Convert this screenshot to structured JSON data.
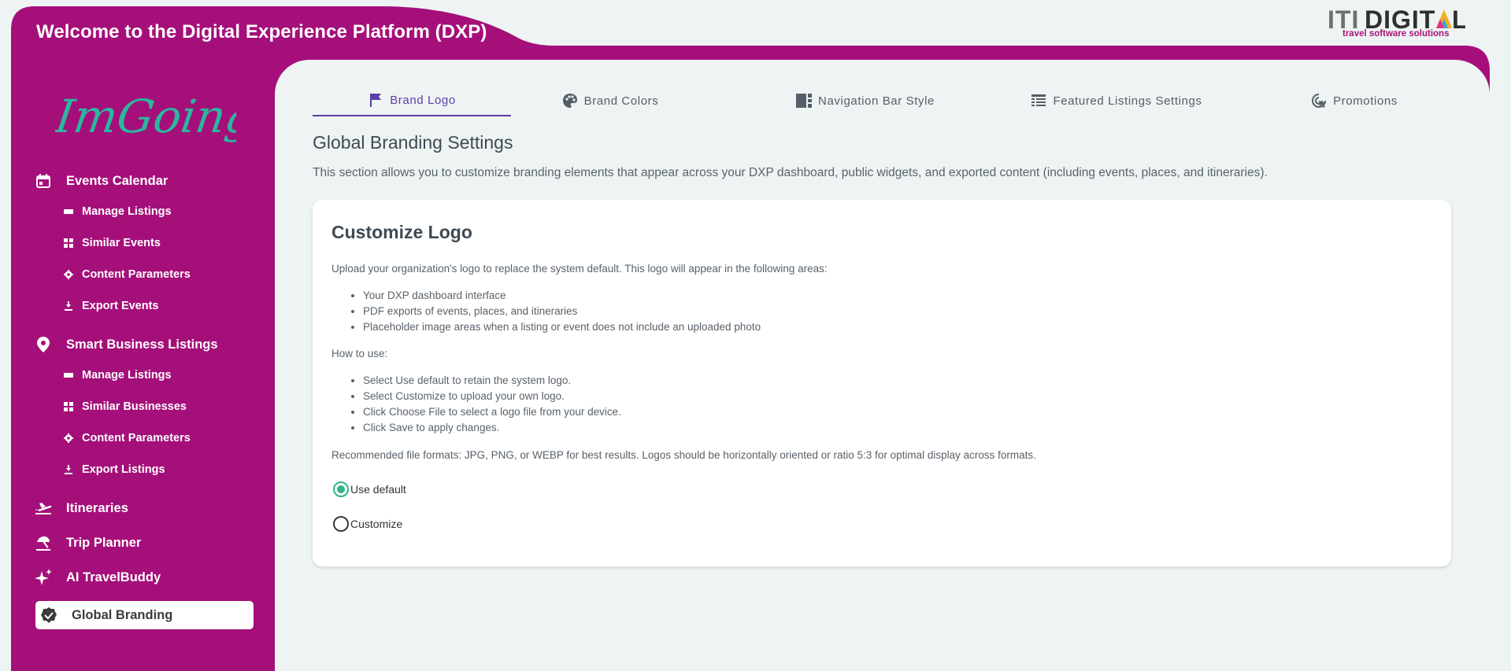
{
  "app": {
    "title": "Welcome to the Digital Experience Platform (DXP)",
    "brand_color": "#a50f7a"
  },
  "partner_logo": {
    "word": "ITIDIGITAL",
    "tagline": "travel software solutions"
  },
  "sidebar": {
    "brand_mark": "ImGoing",
    "items": [
      {
        "label": "Events Calendar",
        "icon": "calendar-icon",
        "level": "top"
      },
      {
        "label": "Manage Listings",
        "icon": "list-icon",
        "level": "sub"
      },
      {
        "label": "Similar Events",
        "icon": "grid-icon",
        "level": "sub"
      },
      {
        "label": "Content Parameters",
        "icon": "gear-icon",
        "level": "sub"
      },
      {
        "label": "Export Events",
        "icon": "download-icon",
        "level": "sub"
      },
      {
        "label": "Smart Business Listings",
        "icon": "location-pin-icon",
        "level": "top"
      },
      {
        "label": "Manage Listings",
        "icon": "list-icon",
        "level": "sub"
      },
      {
        "label": "Similar Businesses",
        "icon": "grid-icon",
        "level": "sub"
      },
      {
        "label": "Content Parameters",
        "icon": "gear-icon",
        "level": "sub"
      },
      {
        "label": "Export Listings",
        "icon": "download-icon",
        "level": "sub"
      },
      {
        "label": "Itineraries",
        "icon": "plane-takeoff-icon",
        "level": "top"
      },
      {
        "label": "Trip Planner",
        "icon": "beach-umbrella-icon",
        "level": "top"
      },
      {
        "label": "AI TravelBuddy",
        "icon": "sparkle-icon",
        "level": "top"
      },
      {
        "label": "Global Branding",
        "icon": "verified-badge-icon",
        "level": "top",
        "active": true
      }
    ]
  },
  "tabs": [
    {
      "label": "Brand Logo",
      "icon": "flag-icon",
      "active": true
    },
    {
      "label": "Brand Colors",
      "icon": "palette-icon"
    },
    {
      "label": "Navigation Bar Style",
      "icon": "sidebar-layout-icon"
    },
    {
      "label": "Featured Listings Settings",
      "icon": "featured-list-icon"
    },
    {
      "label": "Promotions",
      "icon": "target-click-icon"
    }
  ],
  "main": {
    "title": "Global Branding Settings",
    "description": "This section allows you to customize branding elements that appear across your DXP dashboard, public widgets, and exported content (including events, places, and itineraries).",
    "card": {
      "title": "Customize Logo",
      "intro": "Upload your organization's logo to replace the system default. This logo will appear in the following areas:",
      "areas": [
        "Your DXP dashboard interface",
        "PDF exports of events, places, and itineraries",
        "Placeholder image areas when a listing or event does not include an uploaded photo"
      ],
      "how_to_heading": "How to use:",
      "steps": [
        "Select Use default to retain the system logo.",
        "Select Customize to upload your own logo.",
        "Click Choose File to select a logo file from your device.",
        "Click Save to apply changes."
      ],
      "formats_note": "Recommended file formats: JPG, PNG, or WEBP for best results. Logos should be horizontally oriented or ratio 5:3 for optimal display across formats.",
      "options": [
        {
          "label": "Use default",
          "checked": true
        },
        {
          "label": "Customize",
          "checked": false
        }
      ]
    }
  }
}
